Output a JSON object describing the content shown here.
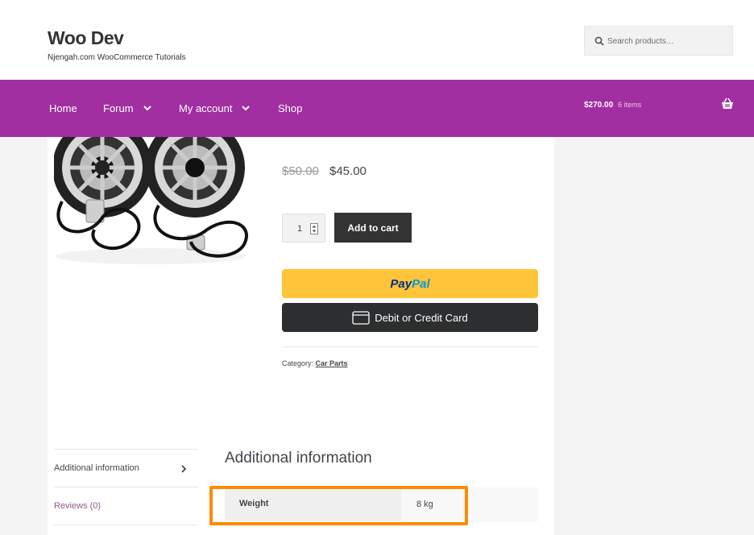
{
  "header": {
    "site_title": "Woo Dev",
    "site_description": "Njengah.com WooCommerce Tutorials",
    "search_placeholder": "Search products…"
  },
  "nav": {
    "items": [
      {
        "label": "Home",
        "has_dropdown": false
      },
      {
        "label": "Forum",
        "has_dropdown": true
      },
      {
        "label": "My account",
        "has_dropdown": true
      },
      {
        "label": "Shop",
        "has_dropdown": false
      }
    ],
    "cart_total": "$270.00",
    "cart_count": "6 items"
  },
  "product": {
    "price_old": "$50.00",
    "price_new": "$45.00",
    "quantity": "1",
    "add_to_cart_label": "Add to cart",
    "paypal_pay": "Pay",
    "paypal_pal": "Pal",
    "card_button_label": "Debit or Credit Card",
    "category_label": "Category: ",
    "category_link": "Car Parts"
  },
  "tabs": {
    "items": [
      {
        "label": "Additional information",
        "active": true
      },
      {
        "label": "Reviews (0)",
        "active": false
      }
    ]
  },
  "additional_info": {
    "title": "Additional information",
    "rows": [
      {
        "label": "Weight",
        "value": "8 kg"
      }
    ]
  },
  "colors": {
    "nav_bg": "#a12fa1",
    "paypal_yellow": "#ffc439",
    "highlight_orange": "#ff8a00",
    "reviews_link": "#96588a"
  }
}
